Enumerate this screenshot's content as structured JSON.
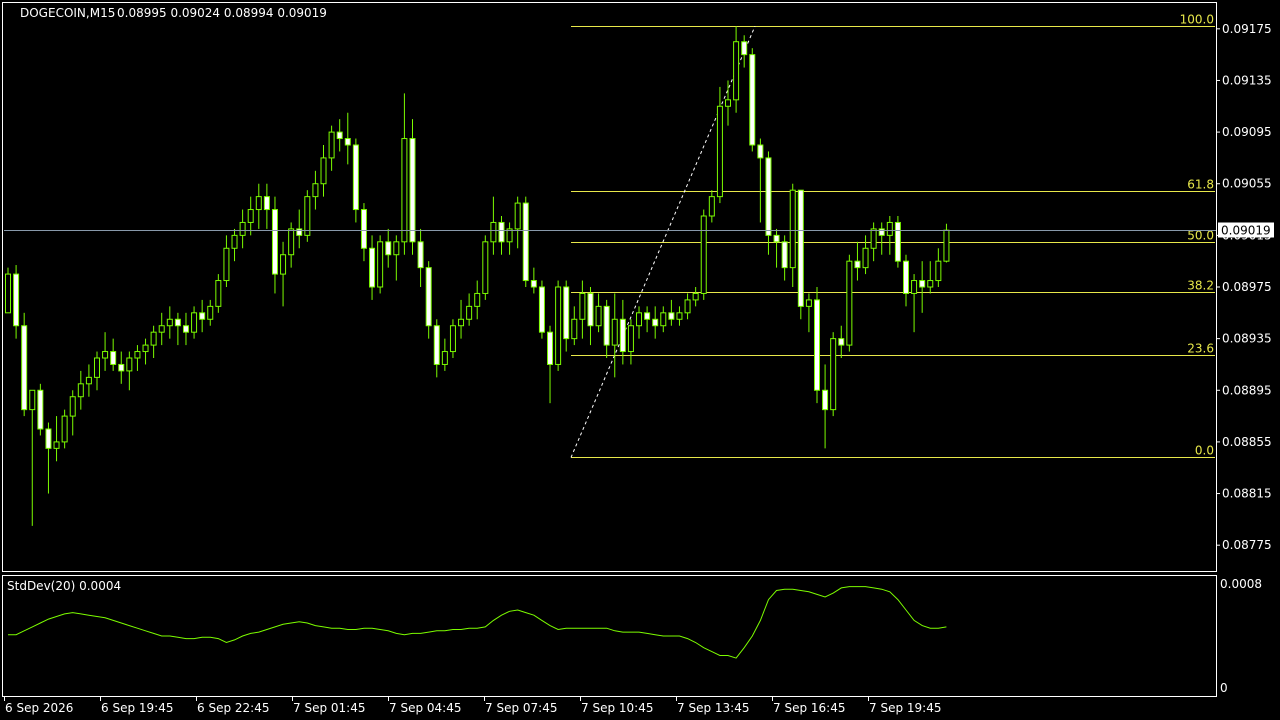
{
  "header": {
    "symbol": "DOGECOIN,M15",
    "ohlc": "0.08995 0.09024 0.08994 0.09019"
  },
  "indicator": {
    "label": "StdDev(20) 0.0004",
    "ticks": [
      "0.0008",
      "0"
    ]
  },
  "price_marker": "0.09019",
  "colors": {
    "background": "#000000",
    "candle_bull": "#000000",
    "candle_bear": "#ffffff",
    "wick": "#7cfc00",
    "fib_line": "#e8e84a",
    "bid_line": "#8899aa",
    "stddev_line": "#7cfc00"
  },
  "chart_data": {
    "type": "candlestick",
    "symbol": "DOGECOIN",
    "timeframe": "M15",
    "ylim": [
      0.08755,
      0.09195
    ],
    "y_ticks": [
      "0.09175",
      "0.09135",
      "0.09095",
      "0.09055",
      "0.09015",
      "0.08975",
      "0.08935",
      "0.08895",
      "0.08855",
      "0.08815",
      "0.08775"
    ],
    "x_ticks": [
      "6 Sep 2026",
      "6 Sep 19:45",
      "6 Sep 22:45",
      "7 Sep 01:45",
      "7 Sep 04:45",
      "7 Sep 07:45",
      "7 Sep 10:45",
      "7 Sep 13:45",
      "7 Sep 16:45",
      "7 Sep 19:45"
    ],
    "current_price": 0.09019,
    "fibonacci": {
      "high": 0.09177,
      "low": 0.08843,
      "levels": [
        {
          "label": "100.0",
          "value": 0.09177
        },
        {
          "label": "61.8",
          "value": 0.09049
        },
        {
          "label": "50.0",
          "value": 0.0901
        },
        {
          "label": "38.2",
          "value": 0.08971
        },
        {
          "label": "23.6",
          "value": 0.08922
        },
        {
          "label": "0.0",
          "value": 0.08843
        }
      ]
    },
    "candles": [
      [
        0.08955,
        0.0899,
        0.0896,
        0.08985
      ],
      [
        0.08985,
        0.08992,
        0.08935,
        0.08945
      ],
      [
        0.08945,
        0.08955,
        0.08875,
        0.0888
      ],
      [
        0.0888,
        0.08895,
        0.0879,
        0.08895
      ],
      [
        0.08895,
        0.089,
        0.0886,
        0.08865
      ],
      [
        0.08865,
        0.0887,
        0.08815,
        0.0885
      ],
      [
        0.0885,
        0.08875,
        0.0884,
        0.08855
      ],
      [
        0.08855,
        0.0888,
        0.0885,
        0.08875
      ],
      [
        0.08875,
        0.08895,
        0.0886,
        0.0889
      ],
      [
        0.0889,
        0.0891,
        0.0888,
        0.089
      ],
      [
        0.089,
        0.08915,
        0.0889,
        0.08905
      ],
      [
        0.08905,
        0.08925,
        0.08895,
        0.0892
      ],
      [
        0.0892,
        0.0894,
        0.0891,
        0.08925
      ],
      [
        0.08925,
        0.08935,
        0.0891,
        0.08915
      ],
      [
        0.08915,
        0.08925,
        0.089,
        0.0891
      ],
      [
        0.0891,
        0.08925,
        0.08895,
        0.0892
      ],
      [
        0.0892,
        0.0893,
        0.0891,
        0.08925
      ],
      [
        0.08925,
        0.08935,
        0.08915,
        0.0893
      ],
      [
        0.0893,
        0.08945,
        0.0892,
        0.0894
      ],
      [
        0.0894,
        0.08955,
        0.0893,
        0.08945
      ],
      [
        0.08945,
        0.0896,
        0.08935,
        0.0895
      ],
      [
        0.0895,
        0.08955,
        0.0893,
        0.08945
      ],
      [
        0.08945,
        0.08955,
        0.0893,
        0.0894
      ],
      [
        0.0894,
        0.0896,
        0.08935,
        0.08955
      ],
      [
        0.08955,
        0.08965,
        0.0894,
        0.0895
      ],
      [
        0.0895,
        0.08965,
        0.08945,
        0.0896
      ],
      [
        0.0896,
        0.08985,
        0.08955,
        0.0898
      ],
      [
        0.0898,
        0.09015,
        0.08975,
        0.09005
      ],
      [
        0.09005,
        0.0902,
        0.08995,
        0.09015
      ],
      [
        0.09015,
        0.09035,
        0.09005,
        0.09025
      ],
      [
        0.09025,
        0.09045,
        0.09015,
        0.09035
      ],
      [
        0.09035,
        0.09055,
        0.0902,
        0.09045
      ],
      [
        0.09045,
        0.09055,
        0.0902,
        0.09035
      ],
      [
        0.09035,
        0.09045,
        0.0897,
        0.08985
      ],
      [
        0.08985,
        0.0901,
        0.0896,
        0.09
      ],
      [
        0.09,
        0.09025,
        0.0899,
        0.0902
      ],
      [
        0.0902,
        0.09035,
        0.09005,
        0.09015
      ],
      [
        0.09015,
        0.0905,
        0.0901,
        0.09045
      ],
      [
        0.09045,
        0.09065,
        0.09035,
        0.09055
      ],
      [
        0.09055,
        0.09085,
        0.09045,
        0.09075
      ],
      [
        0.09075,
        0.091,
        0.09065,
        0.09095
      ],
      [
        0.09095,
        0.09105,
        0.0908,
        0.0909
      ],
      [
        0.0909,
        0.0911,
        0.0907,
        0.09085
      ],
      [
        0.09085,
        0.0909,
        0.09025,
        0.09035
      ],
      [
        0.09035,
        0.0904,
        0.08995,
        0.09005
      ],
      [
        0.09005,
        0.09015,
        0.08965,
        0.08975
      ],
      [
        0.08975,
        0.09015,
        0.0897,
        0.0901
      ],
      [
        0.0901,
        0.0902,
        0.0899,
        0.09
      ],
      [
        0.09,
        0.09015,
        0.0898,
        0.0901
      ],
      [
        0.0901,
        0.09125,
        0.09,
        0.0909
      ],
      [
        0.0909,
        0.09105,
        0.09,
        0.0901
      ],
      [
        0.0901,
        0.0902,
        0.08975,
        0.0899
      ],
      [
        0.0899,
        0.08995,
        0.08935,
        0.08945
      ],
      [
        0.08945,
        0.0895,
        0.08905,
        0.08915
      ],
      [
        0.08915,
        0.08935,
        0.0891,
        0.08925
      ],
      [
        0.08925,
        0.0895,
        0.0892,
        0.08945
      ],
      [
        0.08945,
        0.08965,
        0.08935,
        0.0895
      ],
      [
        0.0895,
        0.0897,
        0.08945,
        0.0896
      ],
      [
        0.0896,
        0.0898,
        0.0895,
        0.0897
      ],
      [
        0.0897,
        0.09015,
        0.08965,
        0.0901
      ],
      [
        0.0901,
        0.09045,
        0.09,
        0.09025
      ],
      [
        0.09025,
        0.0903,
        0.09,
        0.0901
      ],
      [
        0.0901,
        0.09025,
        0.09,
        0.0902
      ],
      [
        0.0902,
        0.09045,
        0.09005,
        0.0904
      ],
      [
        0.0904,
        0.09045,
        0.08975,
        0.0898
      ],
      [
        0.0898,
        0.0899,
        0.0897,
        0.08975
      ],
      [
        0.08975,
        0.0898,
        0.08935,
        0.0894
      ],
      [
        0.0894,
        0.08945,
        0.08885,
        0.08915
      ],
      [
        0.08915,
        0.0898,
        0.0891,
        0.08975
      ],
      [
        0.08975,
        0.0898,
        0.08925,
        0.08935
      ],
      [
        0.08935,
        0.0896,
        0.0893,
        0.0895
      ],
      [
        0.0895,
        0.0898,
        0.08935,
        0.0897
      ],
      [
        0.0897,
        0.08975,
        0.0893,
        0.08945
      ],
      [
        0.08945,
        0.0897,
        0.0894,
        0.0896
      ],
      [
        0.0896,
        0.08965,
        0.0892,
        0.0893
      ],
      [
        0.0893,
        0.0897,
        0.08905,
        0.0895
      ],
      [
        0.0895,
        0.08965,
        0.08915,
        0.08925
      ],
      [
        0.08925,
        0.0895,
        0.08915,
        0.08945
      ],
      [
        0.08945,
        0.0896,
        0.08935,
        0.08955
      ],
      [
        0.08955,
        0.0896,
        0.0894,
        0.0895
      ],
      [
        0.0895,
        0.0896,
        0.08935,
        0.08945
      ],
      [
        0.08945,
        0.0896,
        0.0894,
        0.08955
      ],
      [
        0.08955,
        0.08965,
        0.08945,
        0.0895
      ],
      [
        0.0895,
        0.0896,
        0.08945,
        0.08955
      ],
      [
        0.08955,
        0.0897,
        0.0895,
        0.08965
      ],
      [
        0.08965,
        0.08975,
        0.0896,
        0.0897
      ],
      [
        0.0897,
        0.09035,
        0.08965,
        0.0903
      ],
      [
        0.0903,
        0.0905,
        0.09025,
        0.09045
      ],
      [
        0.09045,
        0.0913,
        0.0904,
        0.09115
      ],
      [
        0.09115,
        0.09135,
        0.091,
        0.0912
      ],
      [
        0.0912,
        0.09177,
        0.0911,
        0.09165
      ],
      [
        0.09165,
        0.0917,
        0.09145,
        0.09155
      ],
      [
        0.09155,
        0.0916,
        0.0908,
        0.09085
      ],
      [
        0.09085,
        0.0909,
        0.09025,
        0.09075
      ],
      [
        0.09075,
        0.0908,
        0.09,
        0.09015
      ],
      [
        0.09015,
        0.0902,
        0.0899,
        0.0901
      ],
      [
        0.0901,
        0.09015,
        0.0898,
        0.0899
      ],
      [
        0.0899,
        0.09055,
        0.08975,
        0.0905
      ],
      [
        0.0905,
        0.0905,
        0.0895,
        0.0896
      ],
      [
        0.0896,
        0.0897,
        0.0894,
        0.08965
      ],
      [
        0.08965,
        0.08975,
        0.08885,
        0.08895
      ],
      [
        0.08895,
        0.08915,
        0.0885,
        0.0888
      ],
      [
        0.0888,
        0.0894,
        0.08875,
        0.08935
      ],
      [
        0.08935,
        0.08945,
        0.0892,
        0.0893
      ],
      [
        0.0893,
        0.09,
        0.08925,
        0.08995
      ],
      [
        0.08995,
        0.0901,
        0.0898,
        0.0899
      ],
      [
        0.0899,
        0.09015,
        0.08985,
        0.09005
      ],
      [
        0.09005,
        0.09025,
        0.08995,
        0.0902
      ],
      [
        0.0902,
        0.09025,
        0.09,
        0.09015
      ],
      [
        0.09015,
        0.0903,
        0.09,
        0.09025
      ],
      [
        0.09025,
        0.0903,
        0.0899,
        0.08995
      ],
      [
        0.08995,
        0.09,
        0.0896,
        0.0897
      ],
      [
        0.0897,
        0.08985,
        0.0894,
        0.0898
      ],
      [
        0.0898,
        0.08995,
        0.08955,
        0.08975
      ],
      [
        0.08975,
        0.08995,
        0.0897,
        0.0898
      ],
      [
        0.0898,
        0.09005,
        0.08975,
        0.08995
      ],
      [
        0.08995,
        0.09024,
        0.08994,
        0.09019
      ]
    ],
    "stddev": [
      0.00041,
      0.00041,
      0.00044,
      0.00047,
      0.0005,
      0.00053,
      0.00055,
      0.00057,
      0.00058,
      0.00057,
      0.00056,
      0.00055,
      0.00054,
      0.00052,
      0.0005,
      0.00048,
      0.00046,
      0.00044,
      0.00042,
      0.0004,
      0.0004,
      0.00039,
      0.00038,
      0.00038,
      0.00039,
      0.00039,
      0.00038,
      0.00035,
      0.00037,
      0.0004,
      0.00042,
      0.00043,
      0.00045,
      0.00047,
      0.00049,
      0.0005,
      0.00051,
      0.0005,
      0.00048,
      0.00047,
      0.00046,
      0.00046,
      0.00045,
      0.00045,
      0.00046,
      0.00046,
      0.00045,
      0.00044,
      0.00042,
      0.00041,
      0.00042,
      0.00042,
      0.00043,
      0.00044,
      0.00044,
      0.00045,
      0.00045,
      0.00046,
      0.00046,
      0.00047,
      0.00052,
      0.00056,
      0.00059,
      0.0006,
      0.00058,
      0.00056,
      0.00052,
      0.00048,
      0.00045,
      0.00046,
      0.00046,
      0.00046,
      0.00046,
      0.00046,
      0.00046,
      0.00044,
      0.00043,
      0.00043,
      0.00043,
      0.00042,
      0.00041,
      0.0004,
      0.0004,
      0.0004,
      0.00038,
      0.00035,
      0.00031,
      0.00028,
      0.00025,
      0.00025,
      0.00023,
      0.00031,
      0.0004,
      0.00052,
      0.00068,
      0.00075,
      0.00076,
      0.00076,
      0.00075,
      0.00074,
      0.00072,
      0.0007,
      0.00073,
      0.00077,
      0.00078,
      0.00078,
      0.00078,
      0.00077,
      0.00076,
      0.00074,
      0.00068,
      0.0006,
      0.00052,
      0.00048,
      0.00046,
      0.00046,
      0.00047
    ]
  }
}
